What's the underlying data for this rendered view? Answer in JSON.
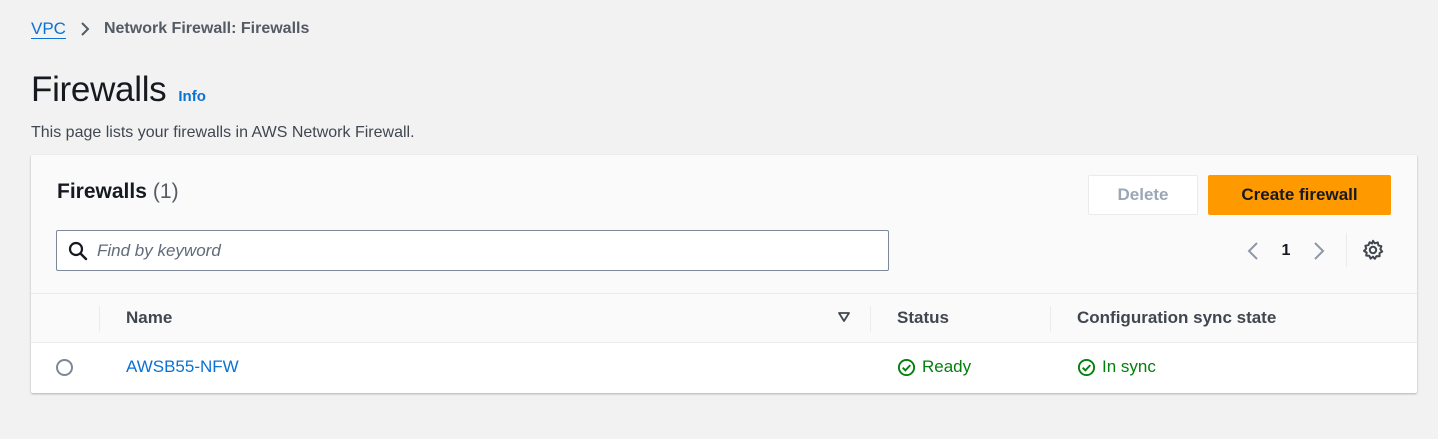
{
  "breadcrumb": {
    "root": "VPC",
    "current": "Network Firewall: Firewalls"
  },
  "header": {
    "title": "Firewalls",
    "info": "Info",
    "description": "This page lists your firewalls in AWS Network Firewall."
  },
  "card": {
    "title": "Firewalls",
    "count": "(1)",
    "delete_label": "Delete",
    "create_label": "Create firewall",
    "search_placeholder": "Find by keyword",
    "page_number": "1"
  },
  "table": {
    "columns": [
      "Name",
      "Status",
      "Configuration sync state"
    ],
    "rows": [
      {
        "name": "AWSB55-NFW",
        "status": "Ready",
        "sync": "In sync"
      }
    ]
  },
  "colors": {
    "link": "#0972d3",
    "primary_button": "#ff9900",
    "success": "#037f0c"
  },
  "icons": [
    "chevron-right-icon",
    "search-icon",
    "chevron-left-icon",
    "settings-gear-icon",
    "sort-triangle-icon",
    "status-check-icon"
  ]
}
